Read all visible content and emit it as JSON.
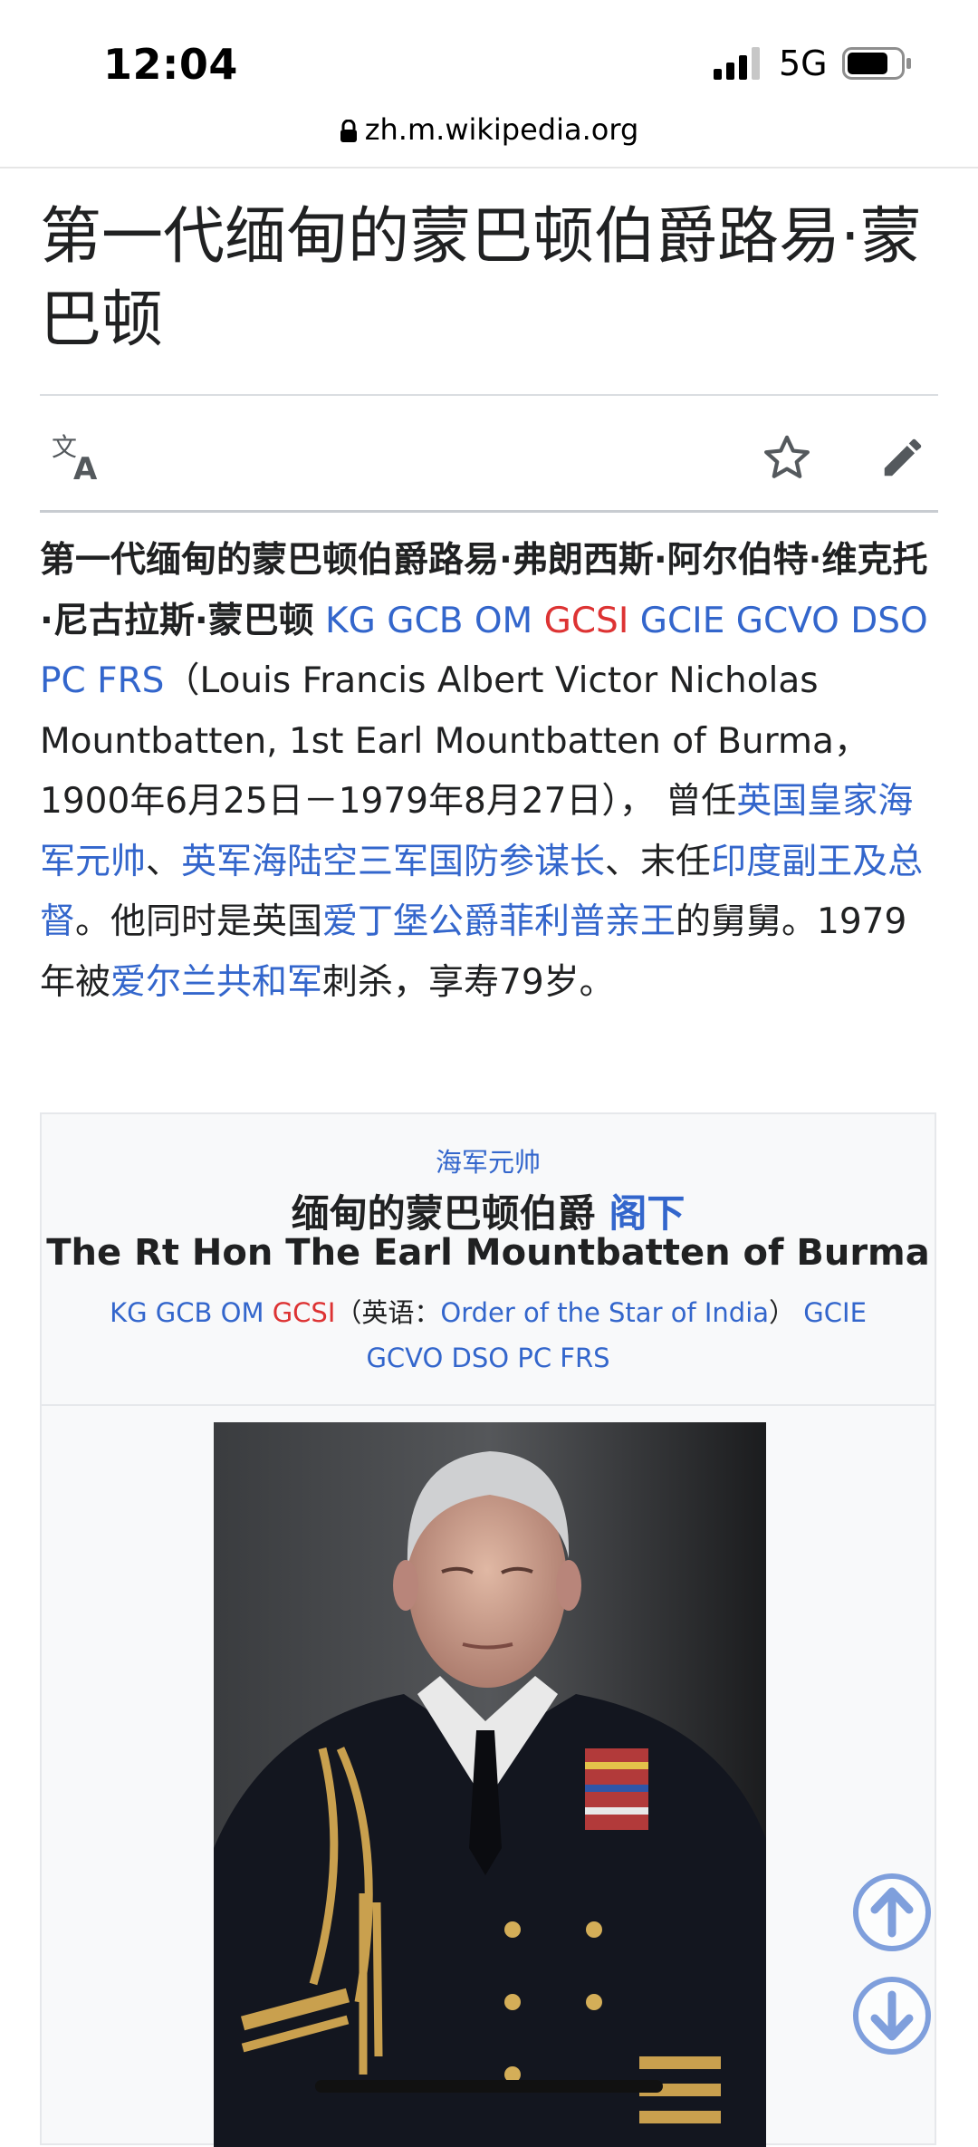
{
  "status_bar": {
    "time": "12:04",
    "network": "5G",
    "url": "zh.m.wikipedia.org"
  },
  "article": {
    "title": "第一代缅甸的蒙巴顿伯爵路易·蒙巴顿",
    "toolbar": {
      "language_icon": "language-icon",
      "star_icon": "star-icon",
      "edit_icon": "pencil-icon"
    },
    "lead": {
      "bold_name": "第一代缅甸的蒙巴顿伯爵路易·弗朗西斯·阿尔伯特·维克托·尼古拉斯·蒙巴顿",
      "post_nominals_1": "KG GCB OM",
      "post_nominals_gcsi": "GCSI",
      "post_nominals_2": "GCIE GCVO DSO PC FRS",
      "english_and_dates": "（Louis Francis Albert Victor Nicholas Mountbatten, 1st Earl Mountbatten of Burma，1900年6月25日－1979年8月27日）， 曾任",
      "link_admiral_fleet": "英国皇家海军元帅",
      "sep1": "、",
      "link_chief_defence": "英军海陆空三军国防参谋长",
      "text_last": "、末任",
      "link_viceroy": "印度副王及总督",
      "text_also": "。他同时是英国",
      "link_philip": "爱丁堡公爵菲利普亲王",
      "text_uncle": "的舅舅。1979年被",
      "link_ira": "爱尔兰共和军",
      "text_end": "刺杀，享寿79岁。"
    },
    "infobox": {
      "rank": "海军元帅",
      "name_zh": "缅甸的蒙巴顿伯爵",
      "name_zh_link": "阁下",
      "name_en": "The Rt Hon The Earl Mountbatten of Burma",
      "honours_1": "KG GCB OM",
      "honours_gcsi": "GCSI",
      "honours_paren_open": "（英语：",
      "honours_order_link": "Order of the Star of India",
      "honours_paren_close": "）",
      "honours_gcie": "GCIE",
      "honours_2": "GCVO DSO PC FRS"
    }
  },
  "floating_buttons": {
    "scroll_up_icon": "arrow-up-circle-icon",
    "scroll_down_icon": "arrow-down-circle-icon"
  }
}
